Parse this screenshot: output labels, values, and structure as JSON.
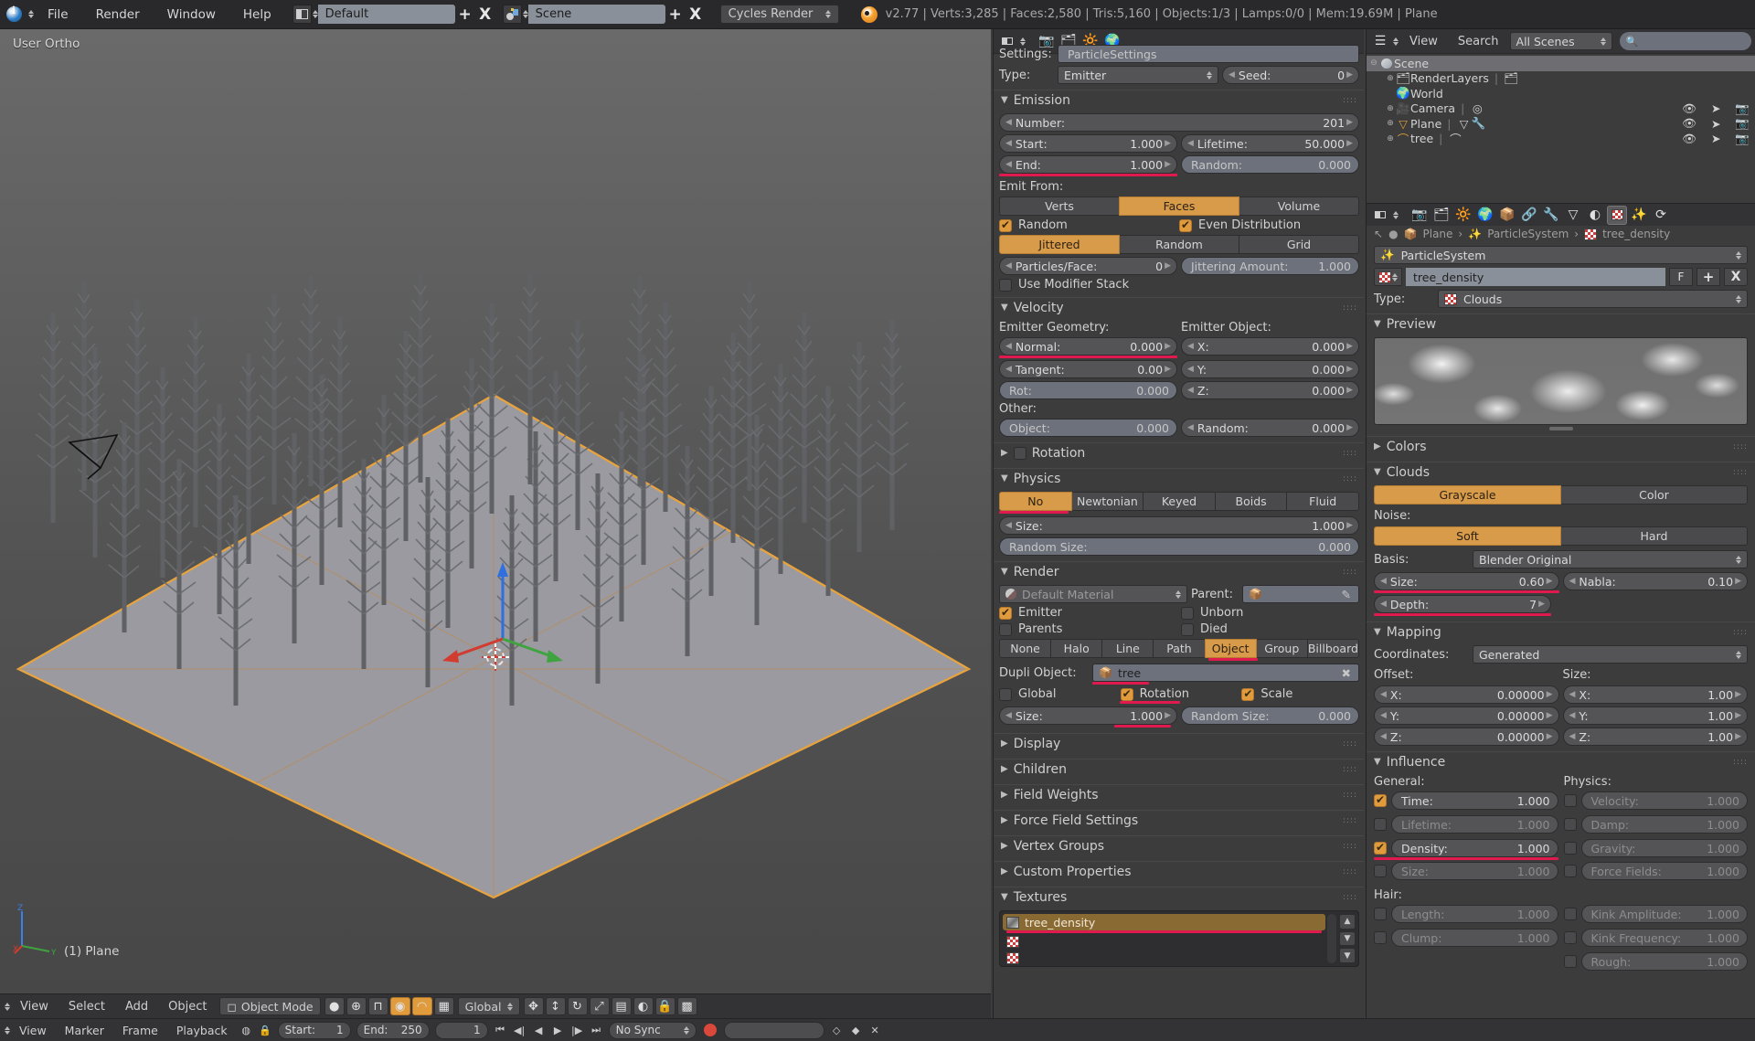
{
  "topbar": {
    "menus": [
      "File",
      "Render",
      "Window",
      "Help"
    ],
    "screen_layout": "Default",
    "scene_name": "Scene",
    "render_engine": "Cycles Render",
    "version": "v2.77",
    "stats": "v2.77 | Verts:3,285 | Faces:2,580 | Tris:5,160 | Objects:1/3 | Lamps:0/0 | Mem:19.69M | Plane",
    "add_label": "+",
    "x_label": "X"
  },
  "viewport": {
    "view_label": "User Ortho",
    "object_label": "(1) Plane",
    "axis_x": "X",
    "axis_y": "Y",
    "axis_z": "Z"
  },
  "viewport_footer": {
    "menus": [
      "View",
      "Select",
      "Add",
      "Object"
    ],
    "mode": "Object Mode",
    "orientation": "Global"
  },
  "timeline": {
    "menus": [
      "View",
      "Marker",
      "Frame",
      "Playback"
    ],
    "start_label": "Start:",
    "start_value": "1",
    "end_label": "End:",
    "end_value": "250",
    "current_frame": "1",
    "sync_mode": "No Sync"
  },
  "particles": {
    "settings_label": "Settings:",
    "settings_value": "ParticleSettings",
    "type_label": "Type:",
    "type_value": "Emitter",
    "seed_label": "Seed:",
    "seed_value": "0",
    "emission": {
      "title": "Emission",
      "number_label": "Number:",
      "number_value": "201",
      "start_label": "Start:",
      "start_value": "1.000",
      "end_label": "End:",
      "end_value": "1.000",
      "lifetime_label": "Lifetime:",
      "lifetime_value": "50.000",
      "random_label": "Random:",
      "random_value": "0.000",
      "emit_from_label": "Emit From:",
      "emit_from_options": [
        "Verts",
        "Faces",
        "Volume"
      ],
      "emit_from_selected": "Faces",
      "random_check": "Random",
      "even_distribution_check": "Even Distribution",
      "dist_options": [
        "Jittered",
        "Random",
        "Grid"
      ],
      "dist_selected": "Jittered",
      "particles_face_label": "Particles/Face:",
      "particles_face_value": "0",
      "jittering_label": "Jittering Amount:",
      "jittering_value": "1.000",
      "use_modifier_stack": "Use Modifier Stack"
    },
    "velocity": {
      "title": "Velocity",
      "emitter_geometry_label": "Emitter Geometry:",
      "emitter_object_label": "Emitter Object:",
      "normal_label": "Normal:",
      "normal_value": "0.000",
      "tangent_label": "Tangent:",
      "tangent_value": "0.00",
      "rot_label": "Rot:",
      "rot_value": "0.000",
      "x_label": "X:",
      "x_value": "0.000",
      "y_label": "Y:",
      "y_value": "0.000",
      "z_label": "Z:",
      "z_value": "0.000",
      "other_label": "Other:",
      "object_label": "Object:",
      "object_value": "0.000",
      "random_label": "Random:",
      "random_value": "0.000"
    },
    "rotation": {
      "title": "Rotation"
    },
    "physics": {
      "title": "Physics",
      "options": [
        "No",
        "Newtonian",
        "Keyed",
        "Boids",
        "Fluid"
      ],
      "selected": "No",
      "size_label": "Size:",
      "size_value": "1.000",
      "random_size_label": "Random Size:",
      "random_size_value": "0.000"
    },
    "render": {
      "title": "Render",
      "material": "Default Material",
      "parent_label": "Parent:",
      "emitter_check": "Emitter",
      "unborn_check": "Unborn",
      "parents_check": "Parents",
      "died_check": "Died",
      "render_as_options": [
        "None",
        "Halo",
        "Line",
        "Path",
        "Object",
        "Group",
        "Billboard"
      ],
      "render_as_selected": "Object",
      "dupli_object_label": "Dupli Object:",
      "dupli_object_value": "tree",
      "global_check": "Global",
      "rotation_check": "Rotation",
      "scale_check": "Scale",
      "size_label": "Size:",
      "size_value": "1.000",
      "random_size_label": "Random Size:",
      "random_size_value": "0.000"
    },
    "collapsed_sections": [
      "Display",
      "Children",
      "Field Weights",
      "Force Field Settings",
      "Vertex Groups",
      "Custom Properties"
    ],
    "textures": {
      "title": "Textures",
      "items": [
        "tree_density",
        "",
        ""
      ],
      "selected": "tree_density"
    }
  },
  "outliner": {
    "menus": [
      "View",
      "Search"
    ],
    "display_mode": "All Scenes",
    "search_placeholder": "",
    "rows": [
      {
        "label": "Scene",
        "icon": "scene-icon",
        "indent": 0,
        "selected": true
      },
      {
        "label": "RenderLayers",
        "icon": "renderlayers-icon",
        "indent": 1,
        "selected": false
      },
      {
        "label": "World",
        "icon": "world-icon",
        "indent": 1,
        "selected": false
      },
      {
        "label": "Camera",
        "icon": "camera-icon",
        "indent": 1,
        "selected": false
      },
      {
        "label": "Plane",
        "icon": "mesh-icon",
        "indent": 1,
        "selected": false
      },
      {
        "label": "tree",
        "icon": "curve-icon",
        "indent": 1,
        "selected": false
      }
    ]
  },
  "texprops": {
    "breadcrumb": [
      "Plane",
      "ParticleSystem",
      "tree_density"
    ],
    "context_value": "ParticleSystem",
    "texture_name": "tree_density",
    "fake_user_label": "F",
    "add_label": "+",
    "delete_label": "X",
    "type_label": "Type:",
    "type_value": "Clouds",
    "preview": {
      "title": "Preview"
    },
    "colors": {
      "title": "Colors"
    },
    "clouds": {
      "title": "Clouds",
      "mode_options": [
        "Grayscale",
        "Color"
      ],
      "mode_selected": "Grayscale",
      "noise_label": "Noise:",
      "noise_options": [
        "Soft",
        "Hard"
      ],
      "noise_selected": "Soft",
      "basis_label": "Basis:",
      "basis_value": "Blender Original",
      "size_label": "Size:",
      "size_value": "0.60",
      "nabla_label": "Nabla:",
      "nabla_value": "0.10",
      "depth_label": "Depth:",
      "depth_value": "7"
    },
    "mapping": {
      "title": "Mapping",
      "coordinates_label": "Coordinates:",
      "coordinates_value": "Generated",
      "offset_label": "Offset:",
      "size_label": "Size:",
      "offset": {
        "x": "0.00000",
        "y": "0.00000",
        "z": "0.00000"
      },
      "size": {
        "x": "1.00",
        "y": "1.00",
        "z": "1.00"
      },
      "x_label": "X:",
      "y_label": "Y:",
      "z_label": "Z:"
    },
    "influence": {
      "title": "Influence",
      "general_label": "General:",
      "physics_label": "Physics:",
      "hair_label": "Hair:",
      "general": [
        {
          "label": "Time:",
          "value": "1.000",
          "on": true
        },
        {
          "label": "Lifetime:",
          "value": "1.000",
          "on": false
        },
        {
          "label": "Density:",
          "value": "1.000",
          "on": true
        },
        {
          "label": "Size:",
          "value": "1.000",
          "on": false
        }
      ],
      "physics": [
        {
          "label": "Velocity:",
          "value": "1.000",
          "on": false
        },
        {
          "label": "Damp:",
          "value": "1.000",
          "on": false
        },
        {
          "label": "Gravity:",
          "value": "1.000",
          "on": false
        },
        {
          "label": "Force Fields:",
          "value": "1.000",
          "on": false
        }
      ],
      "hair_left": [
        {
          "label": "Length:",
          "value": "1.000",
          "on": false
        },
        {
          "label": "Clump:",
          "value": "1.000",
          "on": false
        }
      ],
      "hair_right": [
        {
          "label": "Kink Amplitude:",
          "value": "1.000",
          "on": false
        },
        {
          "label": "Kink Frequency:",
          "value": "1.000",
          "on": false
        },
        {
          "label": "Rough:",
          "value": "1.000",
          "on": false
        }
      ]
    }
  },
  "colors": {
    "accent_orange": "#d79b4a",
    "highlight_red": "#e0194f",
    "panel_bg": "#3c3c3c",
    "header_bg": "#333335"
  }
}
